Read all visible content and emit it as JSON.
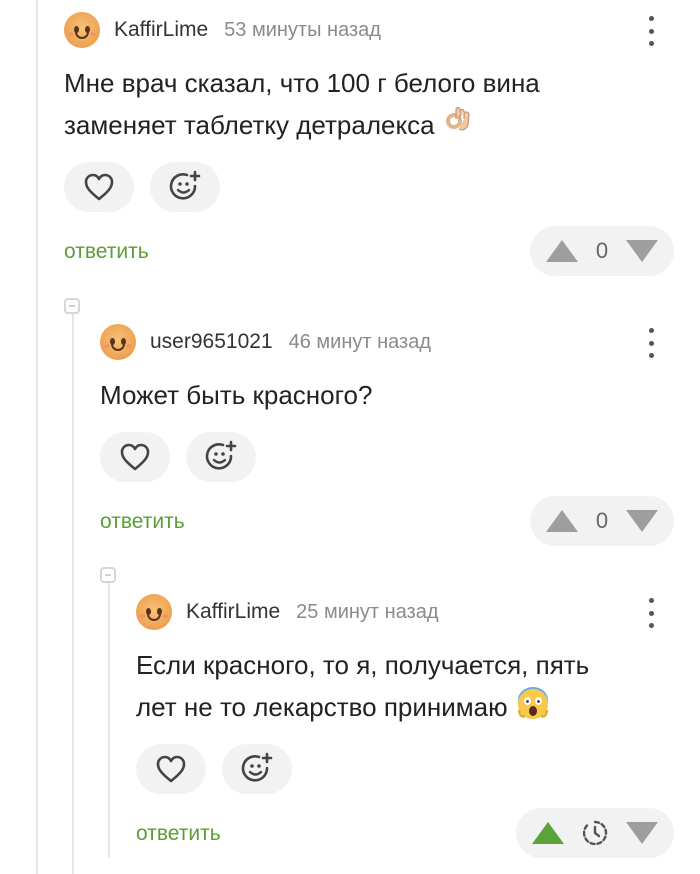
{
  "comments": [
    {
      "username": "KaffirLime",
      "time": "53 минуты назад",
      "text_lines": [
        "Мне врач сказал, что 100 г белого вина",
        "заменяет таблетку детралекса"
      ],
      "emoji": "ok-hand-emoji",
      "reply_label": "ответить",
      "score": "0"
    },
    {
      "username": "user9651021",
      "time": "46 минут назад",
      "text_lines": [
        "Может быть красного?"
      ],
      "reply_label": "ответить",
      "score": "0"
    },
    {
      "username": "KaffirLime",
      "time": "25 минут назад",
      "text_lines": [
        "Если красного, то я, получается, пять",
        "лет не то лекарство принимаю"
      ],
      "emoji": "screaming-face-emoji",
      "reply_label": "ответить",
      "score_icon": "clock-icon",
      "upvoted": true
    }
  ],
  "icons": {
    "like": "heart-icon",
    "react": "add-emoji-icon",
    "upvote": "arrow-up-icon",
    "downvote": "arrow-down-icon",
    "more": "more-vertical-icon",
    "collapse": "collapse-minus-icon"
  },
  "colors": {
    "reply_green": "#5a9e35",
    "upvote_active": "#5aa23a",
    "pill_bg": "#f2f2f2"
  }
}
